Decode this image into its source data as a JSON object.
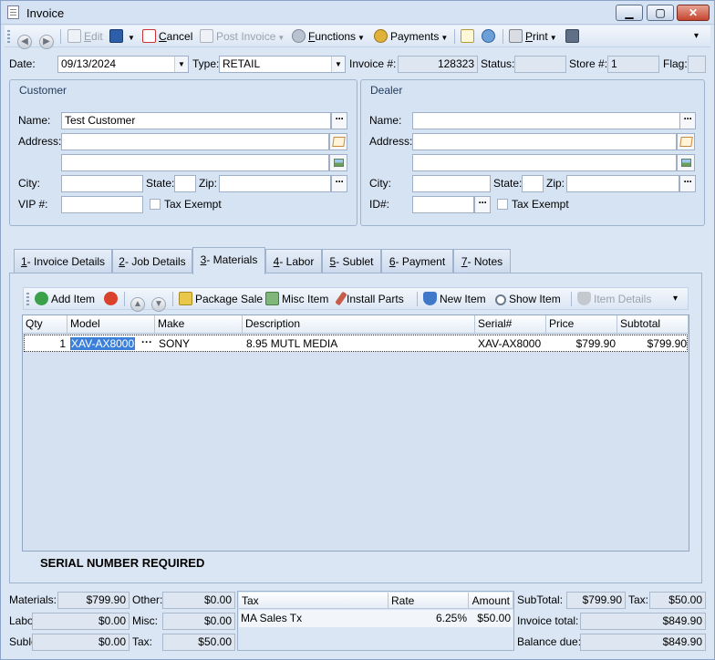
{
  "window": {
    "title": "Invoice",
    "min": "▁",
    "max": "▢",
    "close": "✕"
  },
  "toolbar": {
    "back": "◀",
    "forward": "▶",
    "edit": "Edit",
    "edit_ul": "E",
    "edit_rest": "dit",
    "cancel_ul": "C",
    "cancel_rest": "ancel",
    "post_invoice": "Post Invoice",
    "functions_ul": "F",
    "functions_rest": "unctions",
    "payments": "Payments",
    "print_ul": "P",
    "print_rest": "rint",
    "overflow": "▾"
  },
  "header": {
    "date_label": "Date:",
    "date_value": "09/13/2024",
    "type_label": "Type:",
    "type_value": "RETAIL",
    "invoice_label": "Invoice #:",
    "invoice_value": "128323",
    "status_label": "Status:",
    "status_value": "",
    "store_label": "Store #:",
    "store_value": "1",
    "flag_label": "Flag:",
    "flag_value": ""
  },
  "customer": {
    "title": "Customer",
    "name_label": "Name:",
    "name_value": "Test Customer",
    "address_label": "Address:",
    "address1": "",
    "address2": "",
    "city_label": "City:",
    "city": "",
    "state_label": "State:",
    "state": "",
    "zip_label": "Zip:",
    "zip": "",
    "vip_label": "VIP #:",
    "vip": "",
    "tax_exempt_label": "Tax Exempt"
  },
  "dealer": {
    "title": "Dealer",
    "name_label": "Name:",
    "name_value": "",
    "address_label": "Address:",
    "address1": "",
    "address2": "",
    "city_label": "City:",
    "city": "",
    "state_label": "State:",
    "state": "",
    "zip_label": "Zip:",
    "zip": "",
    "id_label": "ID#:",
    "id": "",
    "tax_exempt_label": "Tax Exempt"
  },
  "tabs": [
    {
      "key": "1",
      "label": "- Invoice Details"
    },
    {
      "key": "2",
      "label": "- Job Details"
    },
    {
      "key": "3",
      "label": "- Materials"
    },
    {
      "key": "4",
      "label": "- Labor"
    },
    {
      "key": "5",
      "label": "- Sublet"
    },
    {
      "key": "6",
      "label": "- Payment"
    },
    {
      "key": "7",
      "label": "- Notes"
    }
  ],
  "materials_toolbar": {
    "add_item": "Add Item",
    "package_sale": "Package Sale",
    "misc_item": "Misc Item",
    "install_parts": "Install Parts",
    "new_item": "New Item",
    "show_item": "Show Item",
    "item_details": "Item Details"
  },
  "grid": {
    "columns": [
      "Qty",
      "Model",
      "Make",
      "Description",
      "Serial#",
      "Price",
      "Subtotal"
    ],
    "rows": [
      {
        "qty": "1",
        "model": "XAV-AX8000",
        "make": "SONY",
        "description": "8.95 MUTL MEDIA",
        "serial": "XAV-AX8000",
        "price": "$799.90",
        "subtotal": "$799.90"
      }
    ]
  },
  "notice": "SERIAL NUMBER REQUIRED",
  "totals": {
    "materials_label": "Materials:",
    "materials": "$799.90",
    "labor_label": "Labor:",
    "labor": "$0.00",
    "sublet_label": "Sublet:",
    "sublet": "$0.00",
    "other_label": "Other:",
    "other": "$0.00",
    "misc_label": "Misc:",
    "misc": "$0.00",
    "tax_label": "Tax:",
    "tax": "$50.00",
    "subtotal_label": "SubTotal:",
    "subtotal": "$799.90",
    "tax2_label": "Tax:",
    "tax2": "$50.00",
    "invoice_total_label": "Invoice total:",
    "invoice_total": "$849.90",
    "balance_due_label": "Balance due:",
    "balance_due": "$849.90"
  },
  "tax_table": {
    "columns": [
      "Tax",
      "Rate",
      "Amount"
    ],
    "rows": [
      {
        "tax": "MA Sales Tx",
        "rate": "6.25%",
        "amount": "$50.00"
      }
    ]
  },
  "colors": {
    "window_bg": "#dbe6f4",
    "selection": "#3c7fd8",
    "delete_red": "#d9412b",
    "add_green": "#3aa04a"
  }
}
